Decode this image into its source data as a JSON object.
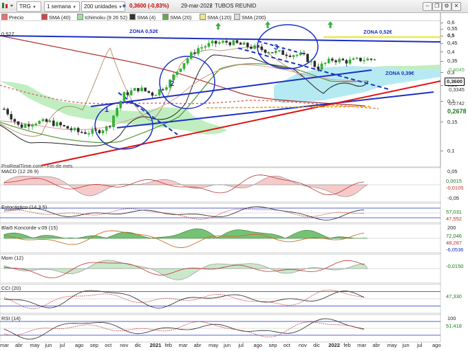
{
  "toolbar": {
    "symbol": "TRG",
    "period": "1 semana",
    "units": "200 unidades",
    "price": "0,3600 (-0,83%)",
    "date": "29-mar-2022",
    "name": "TUBOS REUNID"
  },
  "legend": [
    {
      "label": "Precio",
      "color": "#e57373"
    },
    {
      "label": "SMA (40)",
      "color": "#c94a4a"
    },
    {
      "label": "Ichimoku (9 26 52)",
      "color": "#9fe09f"
    },
    {
      "label": "SMA (4)",
      "color": "#333333"
    },
    {
      "label": "SMA (20)",
      "color": "#6aa84f"
    },
    {
      "label": "SMA (120)",
      "color": "#f0e68c"
    },
    {
      "label": "SMA (200)",
      "color": "#cccccc"
    }
  ],
  "annotations": {
    "left_value": "0,527",
    "zona_left": "ZONA 0,52€",
    "zona_right": "ZONA 0,52€",
    "zona_039": "ZONA 0,39€",
    "circle_1": "1",
    "circle_2": "2",
    "circle_3": "3",
    "watermark": "ProRealTime.com - Fin de mes"
  },
  "price_axis": [
    "0,6",
    "0,55",
    "0,5",
    "0,45",
    "0,4",
    "0,35",
    "0,3",
    "0,25",
    "0,2",
    "0,15",
    "0,1"
  ],
  "price_boxes": [
    {
      "text": "0,4045",
      "color": "#4caf50",
      "bg": "#ffffff"
    },
    {
      "text": "0,3600",
      "color": "#000000",
      "bg": "#ffffff"
    },
    {
      "text": "0,3345",
      "color": "#333333",
      "bg": "#ffffff"
    },
    {
      "text": "0,2742",
      "color": "#333333",
      "bg": "#ffffff"
    },
    {
      "text": "0,2678",
      "color": "#1a7a1a",
      "bg": "#ffffff"
    }
  ],
  "panels": [
    {
      "title": "MACD (12 26 9)",
      "axis_top": "0,05",
      "axis_bottom": "-0,05",
      "values": [
        "0,0015",
        "-0,0105"
      ]
    },
    {
      "title": "Estocástico (14 3 5)",
      "axis_top": "",
      "axis_bottom": "",
      "values": [
        "57,031",
        "47,552"
      ]
    },
    {
      "title": "Blai5 Koncorde v.09 (15)",
      "axis_top": "200",
      "axis_bottom": "",
      "values": [
        "72,046",
        "48,287",
        "-6,0536"
      ]
    },
    {
      "title": "Mom (12)",
      "axis_top": "",
      "axis_bottom": "",
      "values": [
        "-0,0150"
      ]
    },
    {
      "title": "CCI (20)",
      "axis_top": "",
      "axis_bottom": "",
      "values": [
        "47,330"
      ]
    },
    {
      "title": "RSI (14)",
      "axis_top": "100",
      "axis_bottom": "",
      "values": [
        "51,418"
      ]
    }
  ],
  "x_axis": [
    "mar",
    "abr",
    "may",
    "jun",
    "jul",
    "ago",
    "sep",
    "oct",
    "nov",
    "dic",
    "2021",
    "feb",
    "mar",
    "abr",
    "may",
    "jun",
    "jul",
    "ago",
    "sep",
    "oct",
    "nov",
    "dic",
    "2022",
    "feb",
    "mar",
    "abr",
    "may",
    "jun",
    "jul",
    "ago"
  ],
  "chart_data": {
    "type": "candlestick",
    "y_scale": "log",
    "ylim": [
      0.08,
      0.62
    ],
    "x_start": "2020-03",
    "x_end": "2022-08",
    "candle_count": 106,
    "close_anchor_points": [
      [
        "2020-03",
        0.18
      ],
      [
        "2020-04",
        0.14
      ],
      [
        "2020-05",
        0.15
      ],
      [
        "2020-06",
        0.15
      ],
      [
        "2020-07",
        0.14
      ],
      [
        "2020-08",
        0.13
      ],
      [
        "2020-09",
        0.13
      ],
      [
        "2020-10",
        0.14
      ],
      [
        "2020-11",
        0.22
      ],
      [
        "2020-12",
        0.24
      ],
      [
        "2021-01",
        0.22
      ],
      [
        "2021-02",
        0.26
      ],
      [
        "2021-03",
        0.34
      ],
      [
        "2021-04",
        0.42
      ],
      [
        "2021-05",
        0.45
      ],
      [
        "2021-06",
        0.46
      ],
      [
        "2021-07",
        0.44
      ],
      [
        "2021-08",
        0.42
      ],
      [
        "2021-09",
        0.4
      ],
      [
        "2021-10",
        0.39
      ],
      [
        "2021-11",
        0.38
      ],
      [
        "2021-12",
        0.32
      ],
      [
        "2022-01",
        0.36
      ],
      [
        "2022-02",
        0.35
      ],
      [
        "2022-03",
        0.36
      ]
    ],
    "last_close": 0.36,
    "reference_lines": {
      "zona_052": 0.527,
      "zona_039": 0.39
    },
    "levels": [
      0.4045,
      0.36,
      0.3345,
      0.2742,
      0.2678
    ]
  },
  "colors": {
    "trend_blue": "#1a2fc4",
    "trend_red": "#e01010",
    "zona_yellow": "#e8e84a",
    "cloud_green": "#a8e6a8",
    "cloud_cyan": "#9fe6f2",
    "candle_up": "#27a327",
    "candle_down": "#333333"
  }
}
